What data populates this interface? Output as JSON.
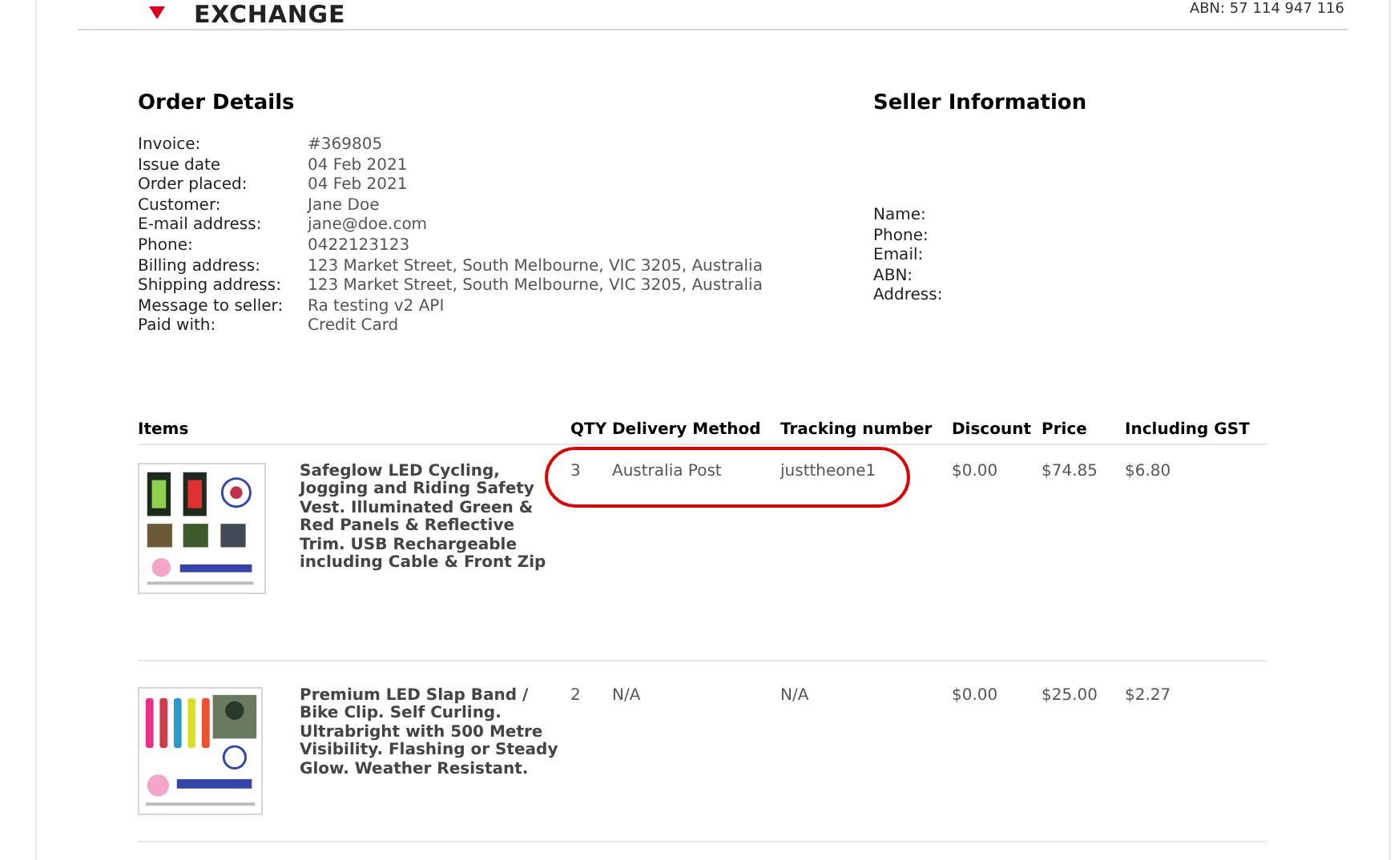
{
  "header": {
    "logo_text": "EXCHANGE",
    "abn": "ABN: 57 114 947 116"
  },
  "order_details": {
    "title": "Order Details",
    "fields": [
      {
        "label": "Invoice:",
        "value": "#369805"
      },
      {
        "label": "Issue date",
        "value": "04 Feb 2021"
      },
      {
        "label": "Order placed:",
        "value": "04 Feb 2021"
      },
      {
        "label": "Customer:",
        "value": "Jane Doe"
      },
      {
        "label": "E-mail address:",
        "value": "jane@doe.com"
      },
      {
        "label": "Phone:",
        "value": "0422123123"
      },
      {
        "label": "Billing address:",
        "value": "123 Market Street, South Melbourne, VIC 3205, Australia"
      },
      {
        "label": "Shipping address:",
        "value": "123 Market Street, South Melbourne, VIC 3205, Australia"
      },
      {
        "label": "Message to seller:",
        "value": "Ra testing v2 API"
      },
      {
        "label": "Paid with:",
        "value": "Credit Card"
      }
    ]
  },
  "seller_information": {
    "title": "Seller Information",
    "fields": [
      "Name:",
      "Phone:",
      "Email:",
      "ABN:",
      "Address:"
    ]
  },
  "items_table": {
    "columns": [
      "Items",
      "QTY",
      "Delivery Method",
      "Tracking number",
      "Discount",
      "Price",
      "Including GST"
    ],
    "rows": [
      {
        "description": "Safeglow LED Cycling, Jogging and Riding Safety Vest. Illuminated Green & Red Panels & Reflective Trim. USB Rechargeable including Cable & Front Zip",
        "qty": "3",
        "delivery_method": "Australia Post",
        "tracking_number": "justtheone1",
        "discount": "$0.00",
        "price": "$74.85",
        "including_gst": "$6.80",
        "highlighted": true
      },
      {
        "description": "Premium LED Slap Band / Bike Clip. Self Curling. Ultrabright with 500 Metre Visibility. Flashing or Steady Glow. Weather Resistant.",
        "qty": "2",
        "delivery_method": "N/A",
        "tracking_number": "N/A",
        "discount": "$0.00",
        "price": "$25.00",
        "including_gst": "$2.27",
        "highlighted": false
      }
    ]
  }
}
